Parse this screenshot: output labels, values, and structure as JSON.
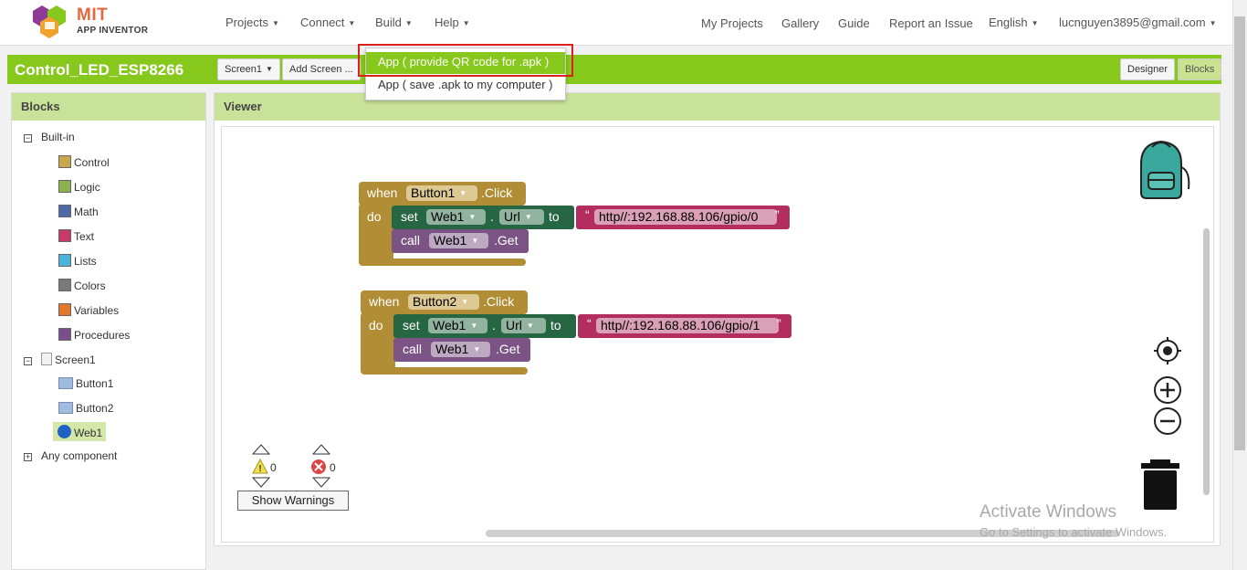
{
  "colors": {
    "toolbar_green": "#86c81c",
    "event_block": "#b18e35",
    "set_block": "#266643",
    "call_block": "#7c5385",
    "string_block": "#b32d5e"
  },
  "logo": {
    "brand": "MIT",
    "product": "APP INVENTOR"
  },
  "nav": {
    "projects": "Projects",
    "connect": "Connect",
    "build": "Build",
    "help": "Help",
    "my_projects": "My Projects",
    "gallery": "Gallery",
    "guide": "Guide",
    "report_issue": "Report an Issue",
    "language": "English",
    "account": "lucnguyen3895@gmail.com"
  },
  "toolbar": {
    "project_name": "Control_LED_ESP8266",
    "screen_select": "Screen1",
    "add_screen": "Add Screen ...",
    "designer": "Designer",
    "blocks": "Blocks"
  },
  "build_menu": {
    "items": [
      "App ( provide QR code for .apk )",
      "App ( save .apk to my computer )"
    ]
  },
  "blocks_panel": {
    "title": "Blocks",
    "built_in": "Built-in",
    "categories": [
      {
        "label": "Control",
        "color": "#c8a84a"
      },
      {
        "label": "Logic",
        "color": "#8ab34d"
      },
      {
        "label": "Math",
        "color": "#4f6aa8"
      },
      {
        "label": "Text",
        "color": "#c83a6b"
      },
      {
        "label": "Lists",
        "color": "#4bb4dc"
      },
      {
        "label": "Colors",
        "color": "#7a7a7a"
      },
      {
        "label": "Variables",
        "color": "#e3772c"
      },
      {
        "label": "Procedures",
        "color": "#7a4e8d"
      }
    ],
    "screen": "Screen1",
    "components": [
      "Button1",
      "Button2",
      "Web1"
    ],
    "any_component": "Any component"
  },
  "viewer": {
    "title": "Viewer",
    "event_blocks": [
      {
        "when": "when",
        "component": "Button1",
        "event": ".Click",
        "do": "do",
        "set": "set",
        "set_component": "Web1",
        "dot": ".",
        "property": "Url",
        "to": "to",
        "url": "http//:192.168.88.106/gpio/0",
        "call": "call",
        "call_component": "Web1",
        "method": ".Get"
      },
      {
        "when": "when",
        "component": "Button2",
        "event": ".Click",
        "do": "do",
        "set": "set",
        "set_component": "Web1",
        "dot": ".",
        "property": "Url",
        "to": "to",
        "url": "http//:192.168.88.106/gpio/1",
        "call": "call",
        "call_component": "Web1",
        "method": ".Get"
      }
    ],
    "warnings_count": "0",
    "errors_count": "0",
    "show_warnings": "Show Warnings"
  },
  "watermark": {
    "line1": "Activate Windows",
    "line2": "Go to Settings to activate Windows."
  }
}
